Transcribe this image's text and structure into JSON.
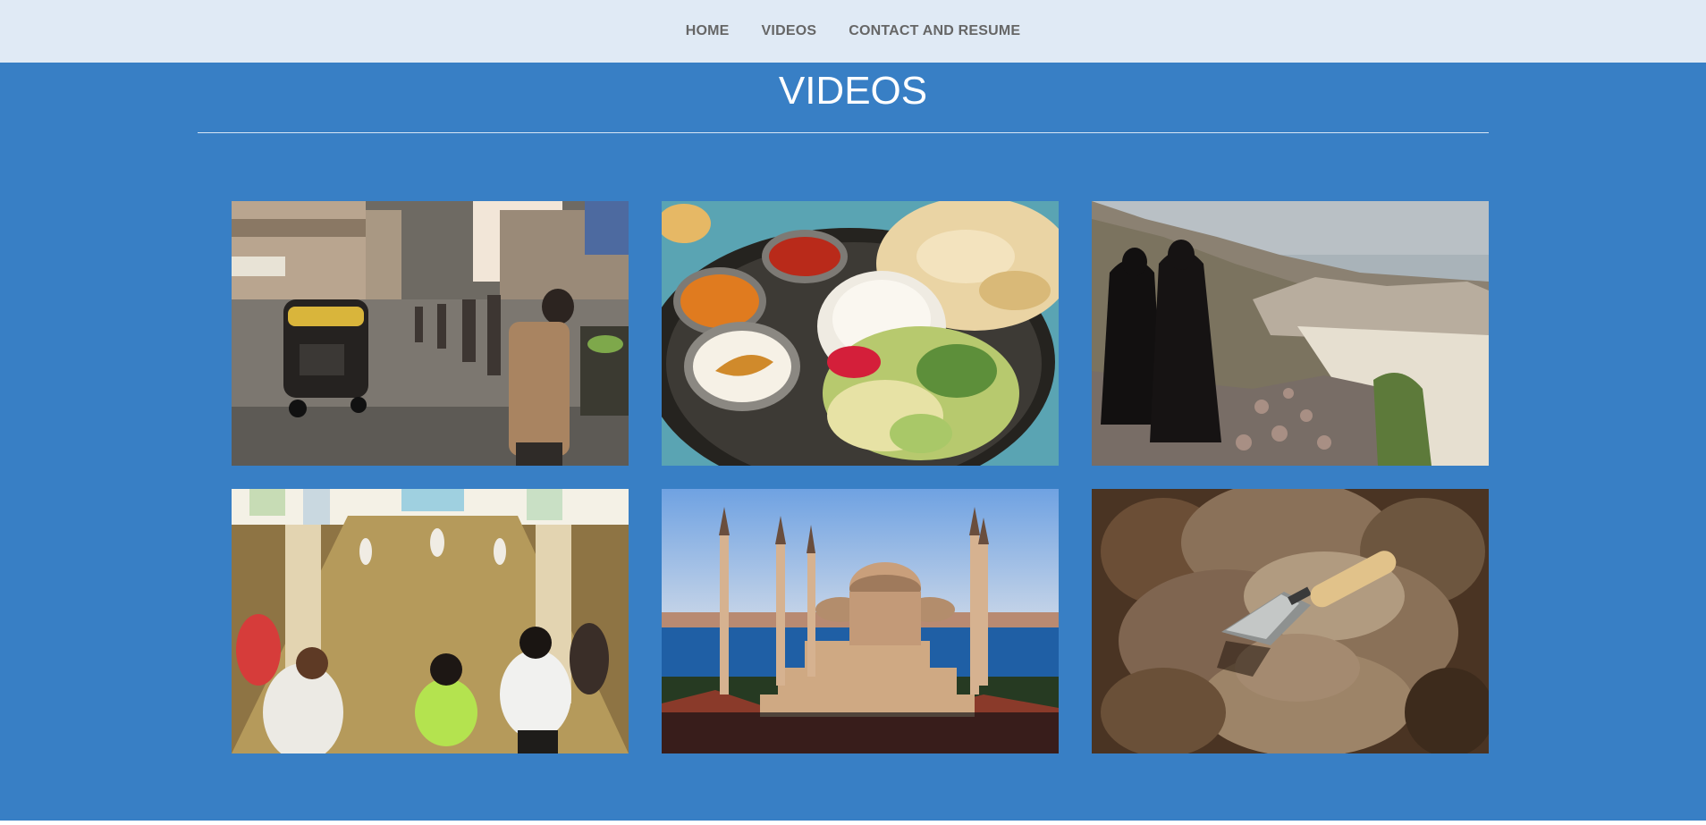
{
  "nav": {
    "items": [
      {
        "label": "HOME"
      },
      {
        "label": "VIDEOS"
      },
      {
        "label": "CONTACT AND RESUME"
      }
    ]
  },
  "page": {
    "title": "VIDEOS"
  },
  "colors": {
    "nav_background": "#e0eaf5",
    "nav_text": "#666666",
    "main_background": "#387fc5",
    "title_text": "#ffffff"
  },
  "gallery": {
    "tiles": [
      {
        "subject": "busy street scene with auto rickshaw"
      },
      {
        "subject": "thali plate with curries, rice, naan and salad"
      },
      {
        "subject": "two women in black robes overlooking mountain town"
      },
      {
        "subject": "group exercise class in a tiled hall"
      },
      {
        "subject": "mosque with minarets beside the sea"
      },
      {
        "subject": "trowel resting on rocky soil"
      }
    ]
  }
}
